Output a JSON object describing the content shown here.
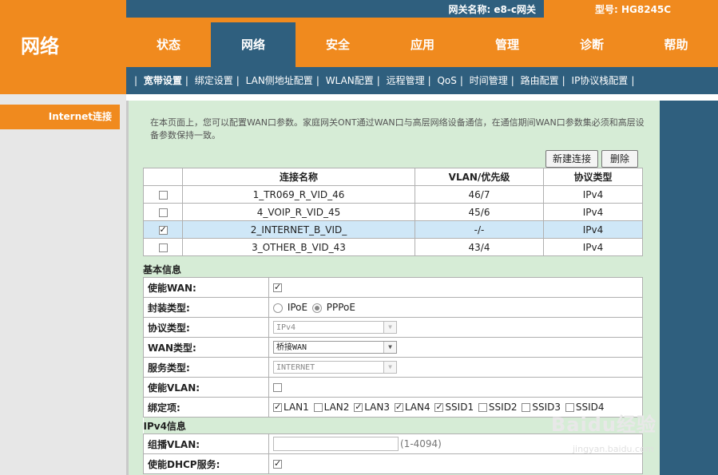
{
  "header": {
    "brand": "网络",
    "gateway_name": "网关名称: e8-c网关",
    "model": "型号: HG8245C"
  },
  "main_nav": [
    {
      "label": "状态",
      "active": false
    },
    {
      "label": "网络",
      "active": true
    },
    {
      "label": "安全",
      "active": false
    },
    {
      "label": "应用",
      "active": false
    },
    {
      "label": "管理",
      "active": false
    },
    {
      "label": "诊断",
      "active": false
    },
    {
      "label": "帮助",
      "active": false
    }
  ],
  "sub_nav": [
    {
      "label": "宽带设置",
      "active": true
    },
    {
      "label": "绑定设置",
      "active": false
    },
    {
      "label": "LAN侧地址配置",
      "active": false
    },
    {
      "label": "WLAN配置",
      "active": false
    },
    {
      "label": "远程管理",
      "active": false
    },
    {
      "label": "QoS",
      "active": false
    },
    {
      "label": "时间管理",
      "active": false
    },
    {
      "label": "路由配置",
      "active": false
    },
    {
      "label": "IP协议栈配置",
      "active": false
    }
  ],
  "sidebar": {
    "item": "Internet连接"
  },
  "description": "在本页面上，您可以配置WAN口参数。家庭网关ONT通过WAN口与高层网络设备通信，在通信期间WAN口参数集必须和高层设备参数保持一致。",
  "buttons": {
    "new_connection": "新建连接",
    "delete": "删除"
  },
  "conn_table": {
    "headers": [
      "连接名称",
      "VLAN/优先级",
      "协议类型"
    ],
    "rows": [
      {
        "name": "1_TR069_R_VID_46",
        "vlan": "46/7",
        "protocol": "IPv4",
        "checked": false
      },
      {
        "name": "4_VOIP_R_VID_45",
        "vlan": "45/6",
        "protocol": "IPv4",
        "checked": false
      },
      {
        "name": "2_INTERNET_B_VID_",
        "vlan": "-/-",
        "protocol": "IPv4",
        "checked": true
      },
      {
        "name": "3_OTHER_B_VID_43",
        "vlan": "43/4",
        "protocol": "IPv4",
        "checked": false
      }
    ]
  },
  "basic_info": {
    "title": "基本信息",
    "enable_wan_label": "使能WAN:",
    "enable_wan": true,
    "encap_label": "封装类型:",
    "encap_options": [
      "IPoE",
      "PPPoE"
    ],
    "encap_selected": "PPPoE",
    "protocol_label": "协议类型:",
    "protocol_value": "IPv4",
    "wan_type_label": "WAN类型:",
    "wan_type_value": "桥接WAN",
    "service_label": "服务类型:",
    "service_value": "INTERNET",
    "enable_vlan_label": "使能VLAN:",
    "enable_vlan": false,
    "binding_label": "绑定项:",
    "bindings": [
      {
        "label": "LAN1",
        "checked": true
      },
      {
        "label": "LAN2",
        "checked": false
      },
      {
        "label": "LAN3",
        "checked": true
      },
      {
        "label": "LAN4",
        "checked": true
      },
      {
        "label": "SSID1",
        "checked": true
      },
      {
        "label": "SSID2",
        "checked": false
      },
      {
        "label": "SSID3",
        "checked": false
      },
      {
        "label": "SSID4",
        "checked": false
      }
    ]
  },
  "ipv4_info": {
    "title": "IPv4信息",
    "multicast_vlan_label": "组播VLAN:",
    "multicast_vlan_value": "",
    "multicast_vlan_hint": "(1-4094)",
    "enable_dhcp_label": "使能DHCP服务:",
    "enable_dhcp": true
  },
  "watermark": {
    "main": "Baidu经验",
    "sub": "jingyan.baidu.com"
  },
  "colors": {
    "orange": "#f08a1e",
    "blue": "#2f5f7e",
    "content_bg": "#d6ecd6",
    "selected_row": "#cfe7f7"
  }
}
